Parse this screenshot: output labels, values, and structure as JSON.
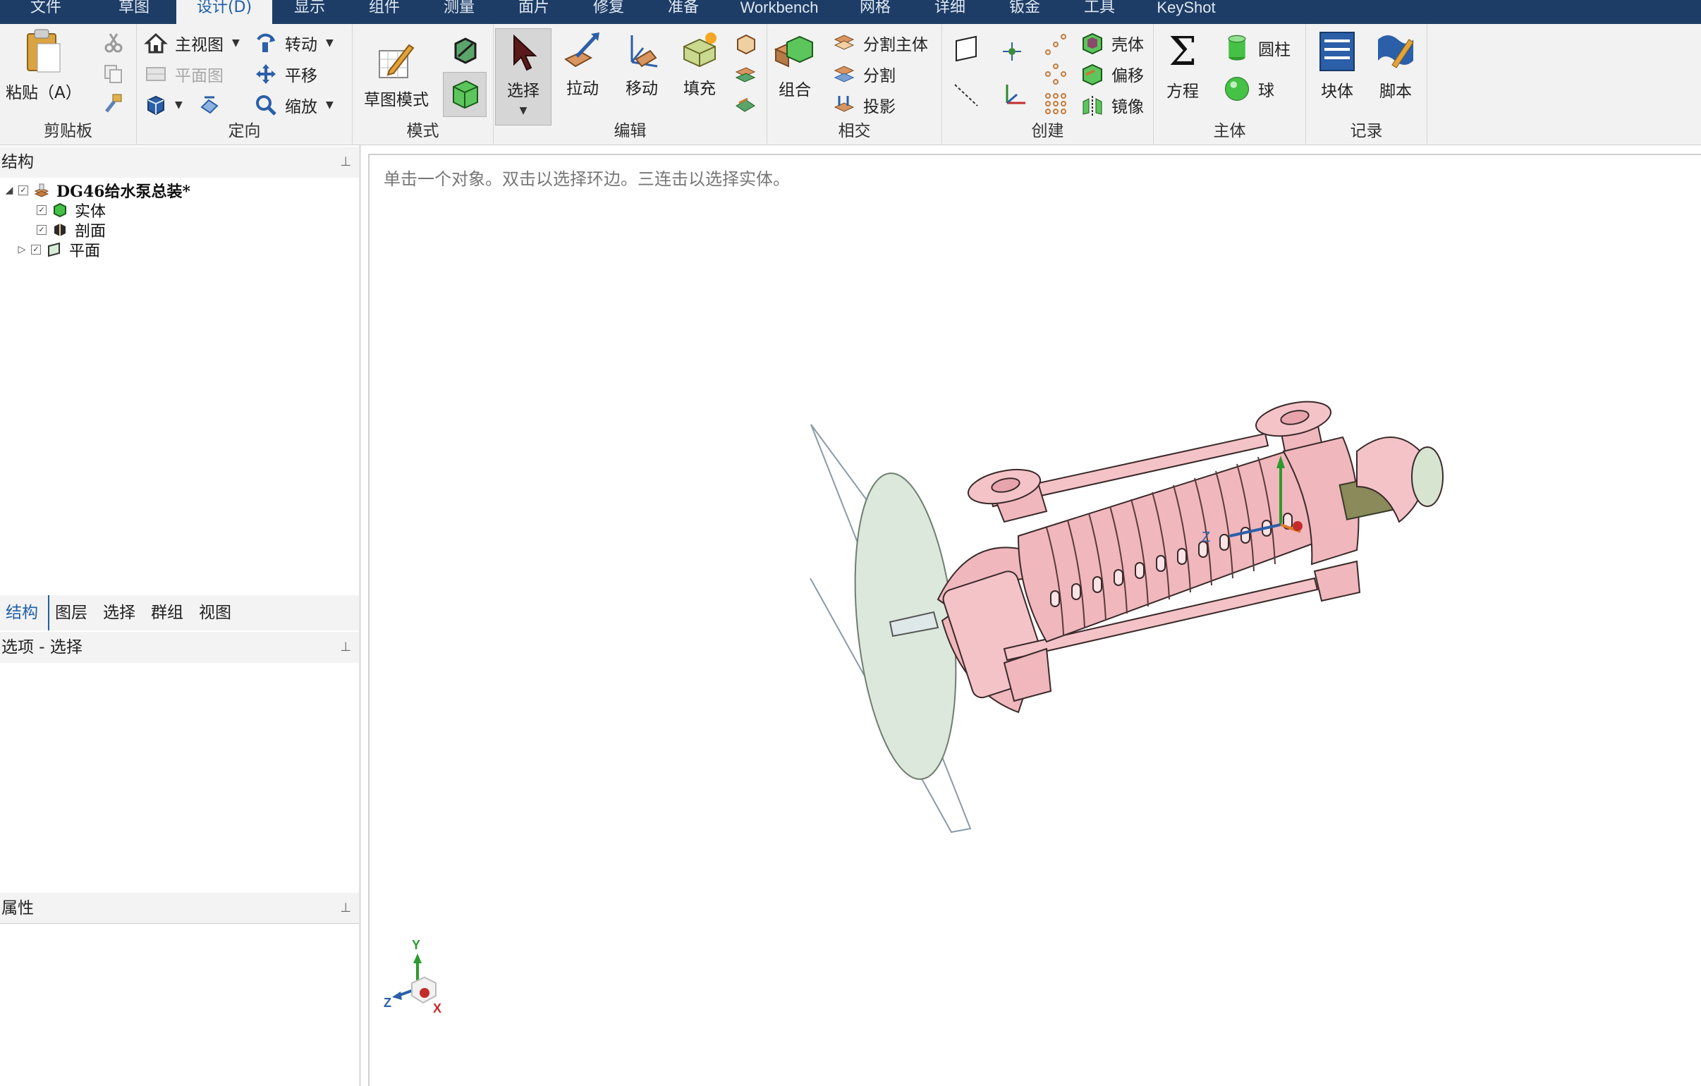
{
  "menu": {
    "tabs": [
      "文件",
      "草图",
      "设计(D)",
      "显示",
      "组件",
      "测量",
      "面片",
      "修复",
      "准备",
      "Workbench",
      "网格",
      "详细",
      "钣金",
      "工具",
      "KeyShot"
    ],
    "active": "设计(D)"
  },
  "ribbon": {
    "clipboard": {
      "label": "剪贴板",
      "paste": "粘贴（A）"
    },
    "orient": {
      "label": "定向",
      "home_view": "主视图",
      "plan_view": "平面图",
      "rotate": "转动",
      "pan": "平移",
      "zoom": "缩放"
    },
    "mode": {
      "label": "模式",
      "sketch_mode": "草图模式"
    },
    "edit": {
      "label": "编辑",
      "select": "选择",
      "pull": "拉动",
      "move": "移动",
      "fill": "填充"
    },
    "intersect": {
      "label": "相交",
      "combine": "组合",
      "split_body": "分割主体",
      "split": "分割",
      "project": "投影"
    },
    "create": {
      "label": "创建",
      "shell": "壳体",
      "offset": "偏移",
      "mirror": "镜像"
    },
    "body": {
      "label": "主体",
      "equation": "方程",
      "cylinder": "圆柱",
      "sphere": "球"
    },
    "record": {
      "label": "记录",
      "block": "块体",
      "script": "脚本"
    }
  },
  "structure": {
    "title": "结构",
    "root": "DG46给水泵总装*",
    "children": [
      "实体",
      "剖面",
      "平面"
    ]
  },
  "panel_tabs": [
    "结构",
    "图层",
    "选择",
    "群组",
    "视图"
  ],
  "options_title": "选项 - 选择",
  "properties_title": "属性",
  "viewport": {
    "hint": "单击一个对象。双击以选择环边。三连击以选择实体。",
    "triad": {
      "x": "X",
      "y": "Y",
      "z": "Z"
    },
    "model_axis": {
      "z": "Z"
    }
  },
  "colors": {
    "menubar": "#1e3d66",
    "active_tab_text": "#1e5fa8",
    "model_pink": "#f0b7bd",
    "plane_fill": "#dce8dc"
  }
}
